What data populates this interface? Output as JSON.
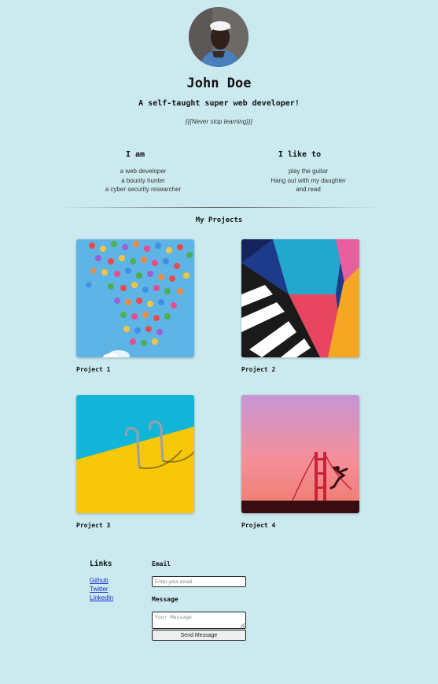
{
  "profile": {
    "avatar_icon": "person-portrait",
    "name": "John Doe",
    "tagline": "A self-taught super web developer!",
    "motto": "{{{Never stop learning}}}"
  },
  "about": {
    "i_am": {
      "heading": "I am",
      "items": [
        "a web developer",
        "a bounty hunter",
        "a cyber security researcher"
      ]
    },
    "i_like": {
      "heading": "I like to",
      "items": [
        "play the guitar",
        "Hang out with my daughter",
        "and read"
      ]
    }
  },
  "projects": {
    "title": "My Projects",
    "items": [
      {
        "label": "Project 1",
        "image": "colorful-balloons-blue-sky"
      },
      {
        "label": "Project 2",
        "image": "abstract-colorful-mural"
      },
      {
        "label": "Project 3",
        "image": "pool-ladder-yellow-blue"
      },
      {
        "label": "Project 4",
        "image": "golden-gate-bridge-pink-sky"
      }
    ]
  },
  "links": {
    "title": "Links",
    "items": [
      "Github",
      "Twitter",
      "LinkedIn"
    ]
  },
  "contact": {
    "email_label": "Email",
    "email_placeholder": "Enter your email",
    "message_label": "Message",
    "message_placeholder": "Your Message",
    "send_label": "Send Message"
  },
  "colors": {
    "background": "#cbeaf0",
    "link": "#1a2bd0"
  }
}
